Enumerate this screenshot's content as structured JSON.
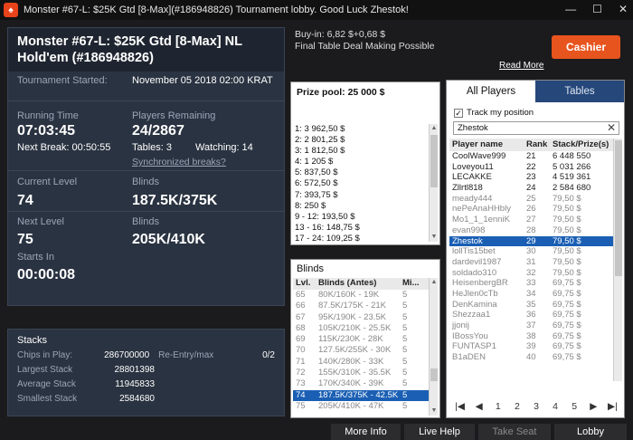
{
  "window": {
    "title": "Monster #67-L: $25K Gtd [8-Max](#186948826) Tournament lobby. Good Luck Zhestok!",
    "minimize": "—",
    "maximize": "☐",
    "close": "✕"
  },
  "info": {
    "name": "Monster #67-L: $25K Gtd [8-Max] NL Hold'em (#186948826)",
    "started_label": "Tournament Started:",
    "started_value": "November 05 2018   02:00 KRAT",
    "running_label": "Running Time",
    "running_value": "07:03:45",
    "next_break": "Next Break: 00:50:55",
    "players_label": "Players Remaining",
    "players_value": "24/2867",
    "tables": "Tables: 3",
    "watching": "Watching: 14",
    "sync_breaks": "Synchronized breaks?",
    "current_level_label": "Current Level",
    "current_level_value": "74",
    "blinds_label": "Blinds",
    "current_blinds": "187.5K/375K",
    "next_level_label": "Next Level",
    "next_level_value": "75",
    "next_blinds_label": "Blinds",
    "next_blinds": "205K/410K",
    "starts_in_label": "Starts In",
    "starts_in_value": "00:00:08"
  },
  "stacks": {
    "title": "Stacks",
    "chips_label": "Chips in Play:",
    "chips_value": "286700000",
    "reentry_label": "Re-Entry/max",
    "reentry_value": "0/2",
    "largest_label": "Largest Stack",
    "largest_value": "28801398",
    "average_label": "Average Stack",
    "average_value": "11945833",
    "smallest_label": "Smallest Stack",
    "smallest_value": "2584680"
  },
  "header": {
    "buyin": "Buy-in: 6,82 $+0,68 $",
    "deal": "Final Table Deal Making Possible",
    "cashier": "Cashier",
    "read_more": "Read More"
  },
  "prize": {
    "title": "Prize pool: 25 000 $",
    "items": [
      "1: 3 962,50 $",
      "2: 2 801,25 $",
      "3: 1 812,50 $",
      "4: 1 205 $",
      "5: 837,50 $",
      "6: 572,50 $",
      "7: 393,75 $",
      "8: 250 $",
      "9 - 12: 193,50 $",
      "13 - 16: 148,75 $",
      "17 - 24: 109,25 $"
    ]
  },
  "blinds": {
    "title": "Blinds",
    "headers": [
      "Lvl.",
      "Blinds (Antes)",
      "Mi..."
    ],
    "rows": [
      [
        "65",
        "80K/160K - 19K",
        "5"
      ],
      [
        "66",
        "87.5K/175K - 21K",
        "5"
      ],
      [
        "67",
        "95K/190K - 23.5K",
        "5"
      ],
      [
        "68",
        "105K/210K - 25.5K",
        "5"
      ],
      [
        "69",
        "115K/230K - 28K",
        "5"
      ],
      [
        "70",
        "127.5K/255K - 30K",
        "5"
      ],
      [
        "71",
        "140K/280K - 33K",
        "5"
      ],
      [
        "72",
        "155K/310K - 35.5K",
        "5"
      ],
      [
        "73",
        "170K/340K - 39K",
        "5"
      ],
      [
        "74",
        "187.5K/375K - 42.5K",
        "5"
      ],
      [
        "75",
        "205K/410K - 47K",
        "5"
      ]
    ]
  },
  "players": {
    "tab_all": "All Players",
    "tab_tables": "Tables",
    "track_label": "Track my position",
    "search_value": "Zhestok",
    "clear": "✕",
    "headers": [
      "Player name",
      "Rank",
      "Stack/Prize(s)"
    ],
    "rows": [
      [
        "CoolWave999",
        "21",
        "6 448 550"
      ],
      [
        "Loveyou11",
        "22",
        "5 031 266"
      ],
      [
        "LECAKKE",
        "23",
        "4 519 361"
      ],
      [
        "Zllrtl818",
        "24",
        "2 584 680"
      ],
      [
        "meady444",
        "25",
        "79,50 $"
      ],
      [
        "nePeAnaHHbly",
        "26",
        "79,50 $"
      ],
      [
        "Mo1_1_1enniK",
        "27",
        "79,50 $"
      ],
      [
        "evan998",
        "28",
        "79,50 $"
      ],
      [
        "Zhestok",
        "29",
        "79,50 $"
      ],
      [
        "lollTis15bet",
        "30",
        "79,50 $"
      ],
      [
        "dardevil1987",
        "31",
        "79,50 $"
      ],
      [
        "soldado310",
        "32",
        "79,50 $"
      ],
      [
        "HeisenbergBR",
        "33",
        "69,75 $"
      ],
      [
        "HeJlen0cTb",
        "34",
        "69,75 $"
      ],
      [
        "DenKamina",
        "35",
        "69,75 $"
      ],
      [
        "Shezzaa1",
        "36",
        "69,75 $"
      ],
      [
        "jjonij",
        "37",
        "69,75 $"
      ],
      [
        "IBossYou",
        "38",
        "69,75 $"
      ],
      [
        "FUNTASP1",
        "39",
        "69,75 $"
      ],
      [
        "B1aDEN",
        "40",
        "69,75 $"
      ]
    ],
    "pager": [
      "|◀",
      "◀",
      "1",
      "2",
      "3",
      "4",
      "5",
      "▶",
      "▶|"
    ]
  },
  "footer": {
    "more_info": "More Info",
    "live_help": "Live Help",
    "take_seat": "Take Seat",
    "lobby": "Lobby"
  },
  "colors": {
    "accent": "#e8541e",
    "selected_row": "#1a5fb4",
    "panel": "#2a3341"
  }
}
